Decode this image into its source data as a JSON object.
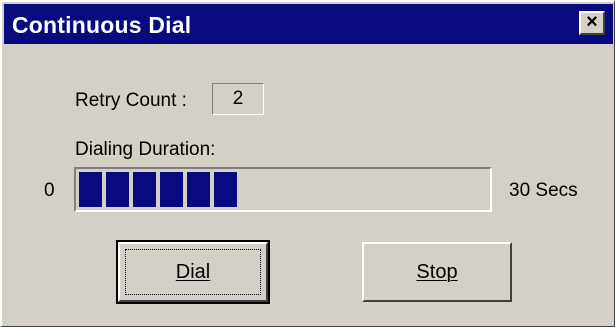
{
  "window": {
    "title": "Continuous Dial",
    "close_glyph": "×",
    "close_icon": "close-icon"
  },
  "retry": {
    "label": "Retry Count :",
    "value": "2"
  },
  "duration": {
    "label": "Dialing Duration:",
    "min_label": "0",
    "max_label": "30  Secs",
    "progress_fraction": 0.4
  },
  "buttons": {
    "dial": "Dial",
    "stop": "Stop"
  },
  "colors": {
    "titlebar": "#0a0a80",
    "progress_fill": "#0a0a80",
    "face": "#d4d0c8"
  }
}
